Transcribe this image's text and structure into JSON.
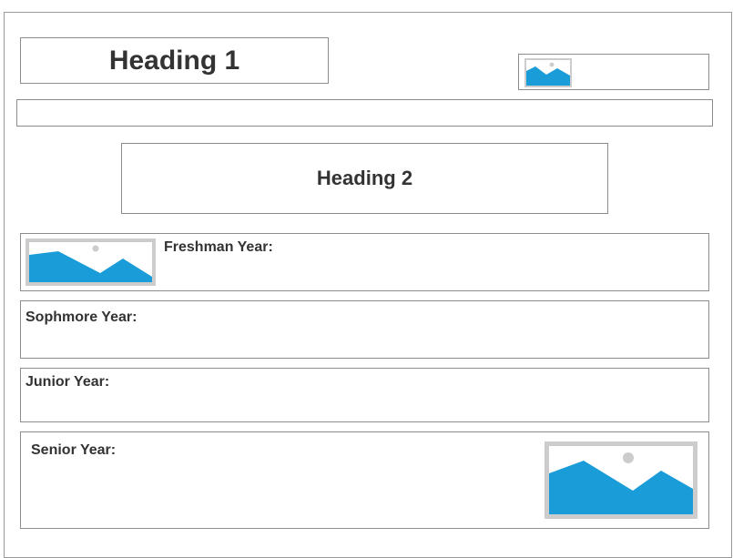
{
  "header": {
    "heading1": "Heading 1",
    "logo_icon": "image-placeholder-icon"
  },
  "section": {
    "heading2": "Heading 2"
  },
  "years": [
    {
      "label": "Freshman Year:",
      "icon": "image-placeholder-icon"
    },
    {
      "label": "Sophmore Year:"
    },
    {
      "label": "Junior Year:"
    },
    {
      "label": "Senior Year:",
      "icon": "image-placeholder-icon"
    }
  ],
  "colors": {
    "image_fill": "#1a9cd8",
    "image_frame": "#cccccc",
    "border": "#8c8c8c",
    "text": "#333333"
  }
}
